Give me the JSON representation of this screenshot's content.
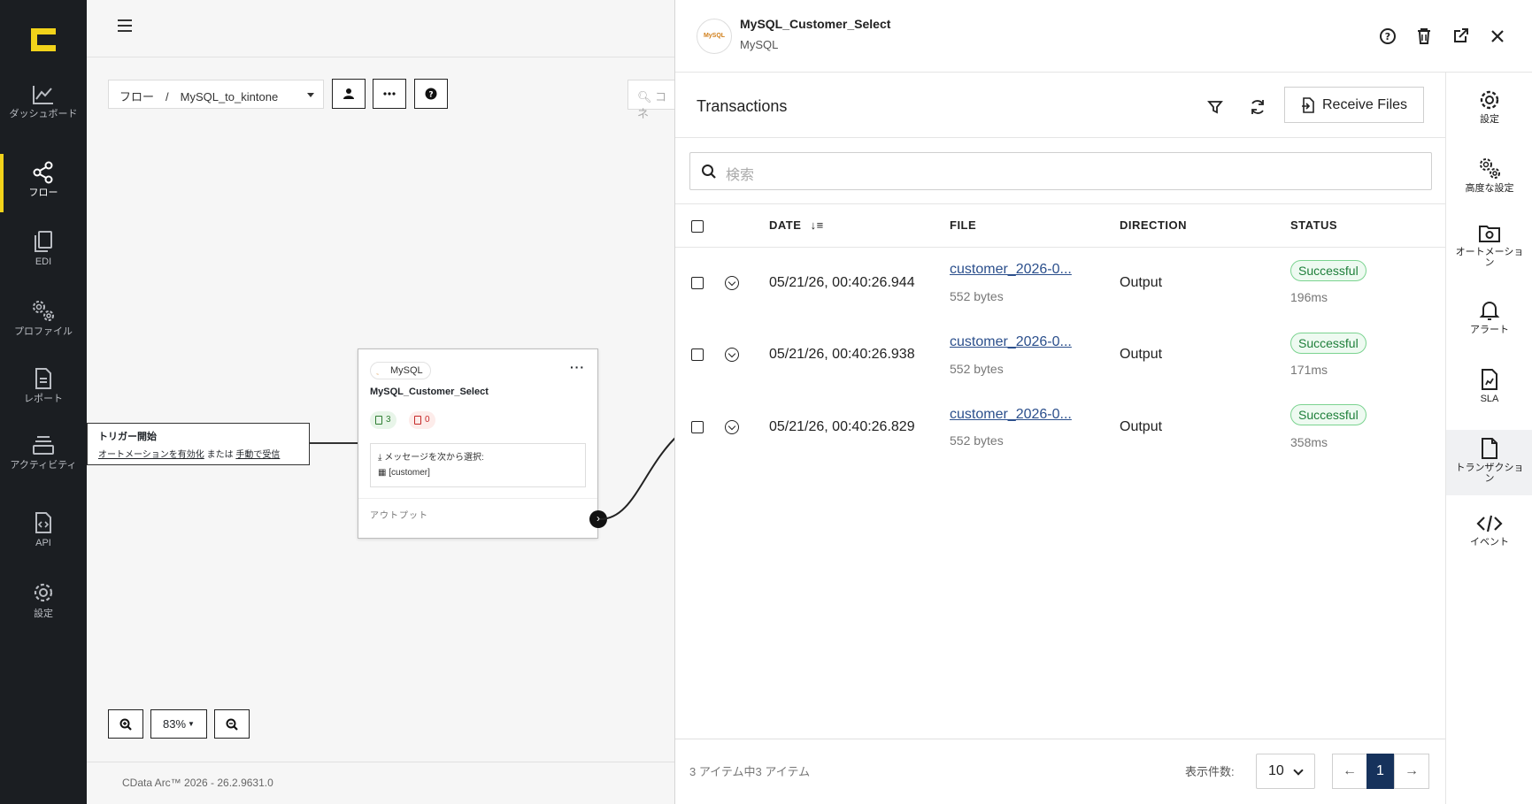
{
  "nav": {
    "items": [
      {
        "label": "ダッシュボード",
        "icon": "chart-line-icon"
      },
      {
        "label": "フロー",
        "icon": "share-nodes-icon"
      },
      {
        "label": "EDI",
        "icon": "documents-icon"
      },
      {
        "label": "プロファイル",
        "icon": "gears-icon"
      },
      {
        "label": "レポート",
        "icon": "report-icon"
      },
      {
        "label": "アクティビティ",
        "icon": "activity-icon"
      },
      {
        "label": "API",
        "icon": "api-file-icon"
      },
      {
        "label": "設定",
        "icon": "gear-icon"
      }
    ],
    "active": "フロー",
    "accent": "#f2d31a"
  },
  "canvas": {
    "breadcrumb": "フロー　/　MySQL_to_kintone",
    "search_placeholder": "コネ",
    "trigger": {
      "title": "トリガー開始",
      "link_automation": "オートメーションを有効化",
      "text_or": "または",
      "link_manual": "手動で受信"
    },
    "node": {
      "type_chip": "MySQL",
      "name": "MySQL_Customer_Select",
      "success_count": "3",
      "error_count": "0",
      "message_line": "メッセージを次から選択:",
      "table_line": "[customer]",
      "output_label": "アウトプット"
    },
    "zoom_level": "83%",
    "footer": "CData Arc™ 2026 - 26.2.9631.0"
  },
  "panel": {
    "title": "MySQL_Customer_Select",
    "subtitle": "MySQL",
    "transactions": {
      "heading": "Transactions",
      "receive_label": "Receive Files",
      "search_placeholder": "検索",
      "columns": {
        "date": "DATE",
        "file": "FILE",
        "direction": "DIRECTION",
        "status": "STATUS"
      },
      "rows": [
        {
          "date": "05/21/26, 00:40:26.944",
          "file": "customer_2026-0...",
          "size": "552 bytes",
          "direction": "Output",
          "status": "Successful",
          "duration": "196ms"
        },
        {
          "date": "05/21/26, 00:40:26.938",
          "file": "customer_2026-0...",
          "size": "552 bytes",
          "direction": "Output",
          "status": "Successful",
          "duration": "171ms"
        },
        {
          "date": "05/21/26, 00:40:26.829",
          "file": "customer_2026-0...",
          "size": "552 bytes",
          "direction": "Output",
          "status": "Successful",
          "duration": "358ms"
        }
      ],
      "count_text": "3 アイテム中3 アイテム",
      "page_size_label": "表示件数:",
      "page_size": "10",
      "current_page": "1"
    },
    "rail": [
      {
        "label": "設定",
        "icon": "gear-icon"
      },
      {
        "label": "高度な設定",
        "icon": "gears-icon"
      },
      {
        "label": "オートメーション",
        "icon": "folder-gear-icon"
      },
      {
        "label": "アラート",
        "icon": "bell-icon"
      },
      {
        "label": "SLA",
        "icon": "sla-file-icon"
      },
      {
        "label": "トランザクション",
        "icon": "file-icon"
      },
      {
        "label": "イベント",
        "icon": "code-icon"
      }
    ],
    "rail_active": "トランザクション"
  }
}
